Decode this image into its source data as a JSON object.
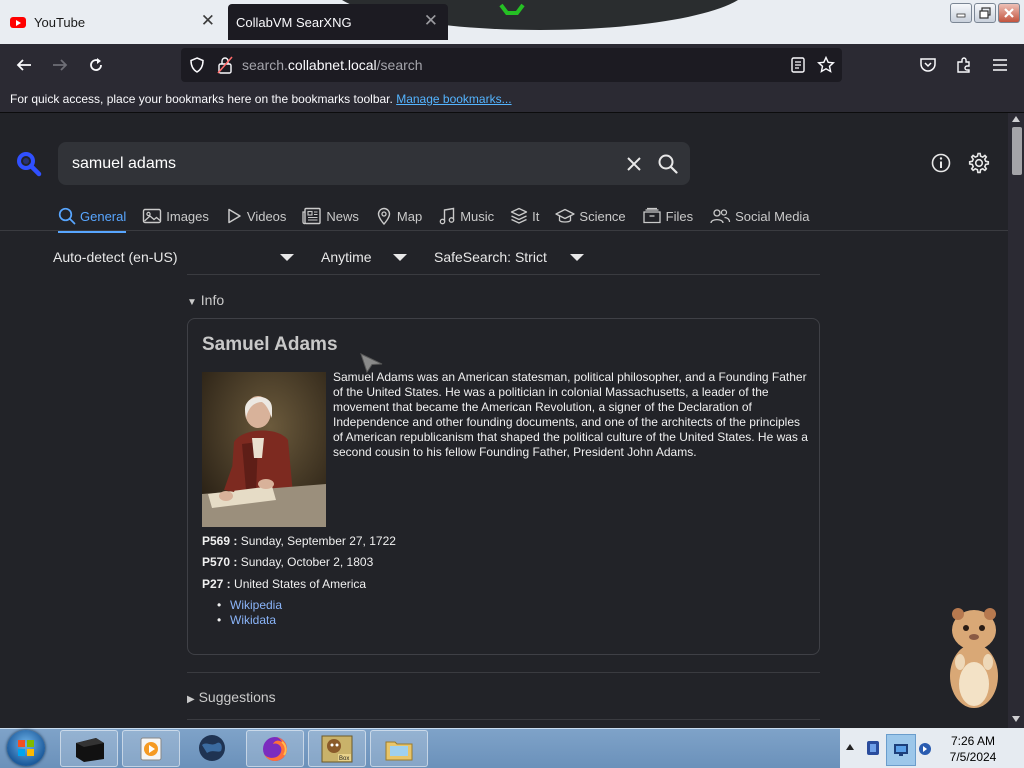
{
  "browser": {
    "tabs": [
      {
        "label": "YouTube",
        "icon": "youtube-icon",
        "active": false
      },
      {
        "label": "CollabVM SearXNG",
        "icon": "none",
        "active": true
      }
    ],
    "url": {
      "host_prefix": "search.",
      "host_main": "collabnet.local",
      "path": "/search"
    },
    "bookmarks_bar": {
      "text": "For quick access, place your bookmarks here on the bookmarks toolbar.",
      "link": "Manage bookmarks..."
    }
  },
  "search": {
    "query": "samuel adams",
    "categories": [
      {
        "label": "General",
        "icon": "search-icon",
        "active": true
      },
      {
        "label": "Images",
        "icon": "image-icon",
        "active": false
      },
      {
        "label": "Videos",
        "icon": "play-icon",
        "active": false
      },
      {
        "label": "News",
        "icon": "newspaper-icon",
        "active": false
      },
      {
        "label": "Map",
        "icon": "map-pin-icon",
        "active": false
      },
      {
        "label": "Music",
        "icon": "music-note-icon",
        "active": false
      },
      {
        "label": "It",
        "icon": "layers-icon",
        "active": false
      },
      {
        "label": "Science",
        "icon": "graduation-cap-icon",
        "active": false
      },
      {
        "label": "Files",
        "icon": "files-icon",
        "active": false
      },
      {
        "label": "Social Media",
        "icon": "people-icon",
        "active": false
      }
    ],
    "filters": {
      "language": "Auto-detect (en-US)",
      "time": "Anytime",
      "safesearch": "SafeSearch: Strict"
    }
  },
  "infobox": {
    "section_label": "Info",
    "title": "Samuel Adams",
    "description": "Samuel Adams was an American statesman, political philosopher, and a Founding Father of the United States. He was a politician in colonial Massachusetts, a leader of the movement that became the American Revolution, a signer of the Declaration of Independence and other founding documents, and one of the architects of the principles of American republicanism that shaped the political culture of the United States. He was a second cousin to his fellow Founding Father, President John Adams.",
    "properties": [
      {
        "key": "P569 :",
        "value": "Sunday, September 27, 1722"
      },
      {
        "key": "P570 :",
        "value": "Sunday, October 2, 1803"
      },
      {
        "key": "P27 :",
        "value": "United States of America"
      }
    ],
    "links": [
      "Wikipedia",
      "Wikidata"
    ]
  },
  "suggestions_label": "Suggestions",
  "taskbar": {
    "time": "7:26 AM",
    "date": "7/5/2024",
    "items": [
      "terminal-icon",
      "media-player-icon",
      "globe-icon",
      "firefox-icon",
      "game-box-icon",
      "file-manager-icon"
    ]
  },
  "colors": {
    "accent": "#58a6ff",
    "link": "#8ab4f8",
    "page_bg": "#222328",
    "search_bg": "#313338"
  }
}
